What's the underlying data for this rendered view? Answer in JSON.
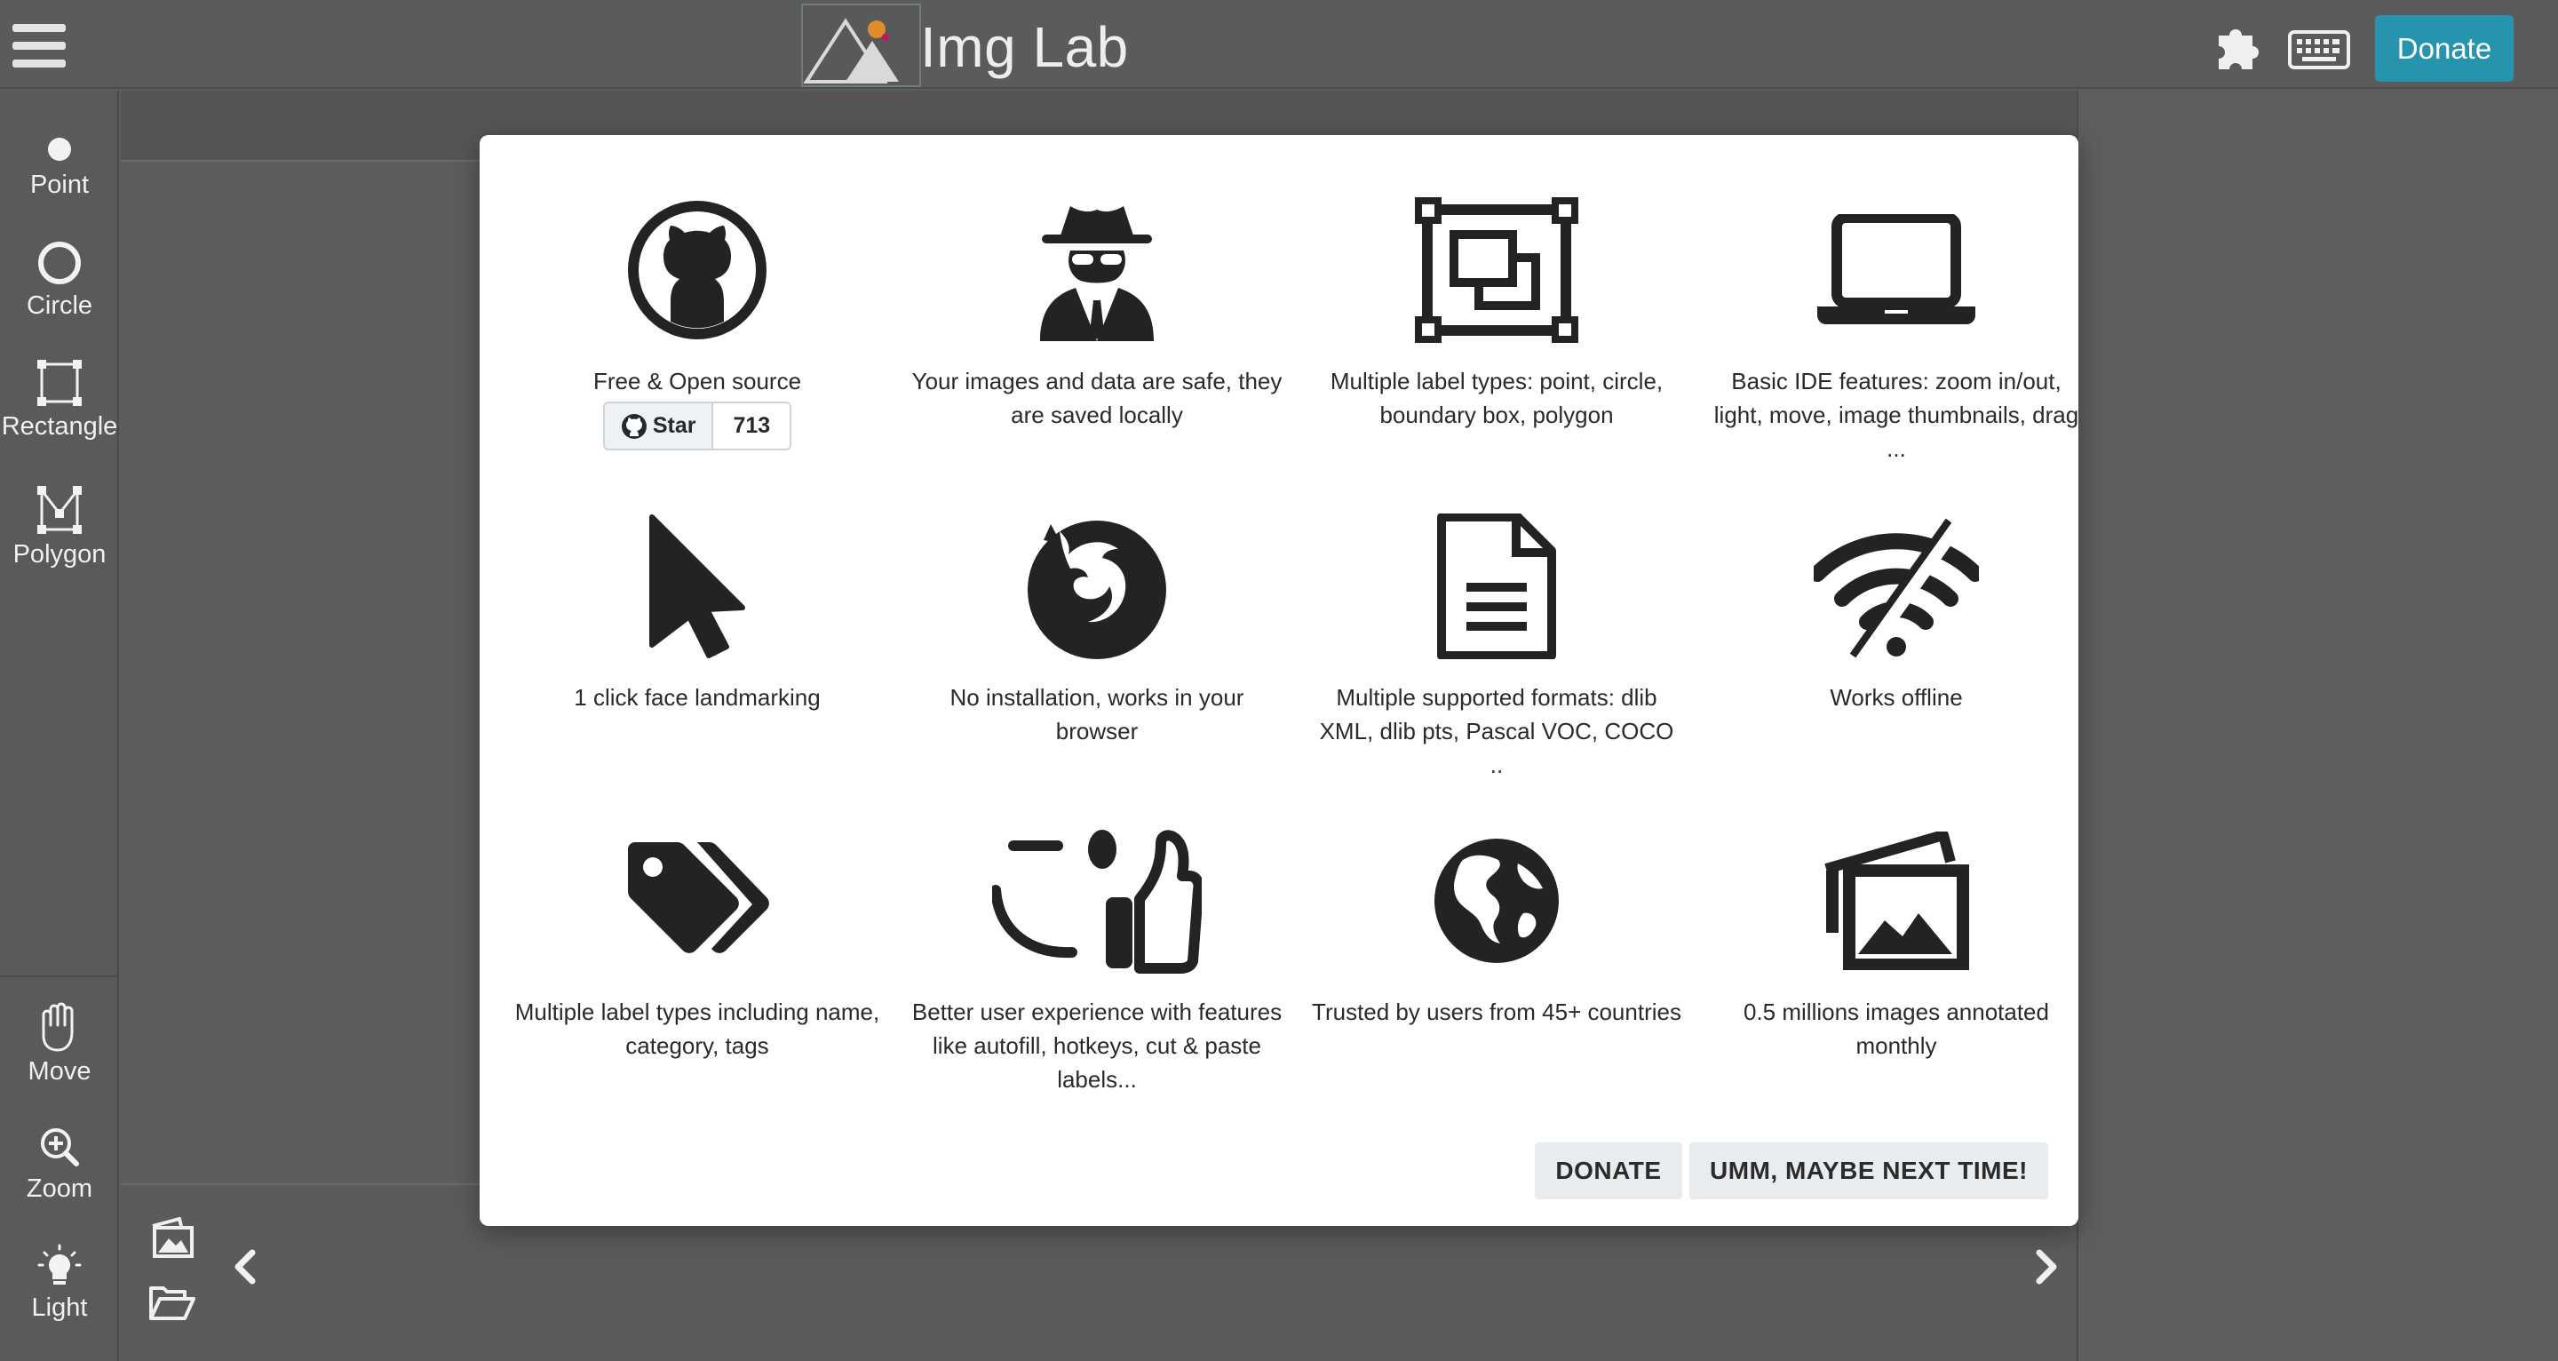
{
  "header": {
    "title": "Img Lab",
    "donate_label": "Donate",
    "icons": [
      "menu-icon",
      "logo-mountain",
      "plugin-icon",
      "keyboard-icon"
    ]
  },
  "toolbar": {
    "tools": [
      {
        "label": "Point",
        "icon": "point-icon"
      },
      {
        "label": "Circle",
        "icon": "circle-icon"
      },
      {
        "label": "Rectangle",
        "icon": "rectangle-icon"
      },
      {
        "label": "Polygon",
        "icon": "polygon-icon"
      }
    ],
    "bottom_tools": [
      {
        "label": "Move",
        "icon": "hand-icon"
      },
      {
        "label": "Zoom",
        "icon": "zoom-icon"
      },
      {
        "label": "Light",
        "icon": "lightbulb-icon"
      }
    ]
  },
  "modal": {
    "features": [
      {
        "text": "Free & Open source",
        "icon": "github-icon"
      },
      {
        "text": "Your images and data are safe, they are saved locally",
        "icon": "incognito-icon"
      },
      {
        "text": "Multiple label types: point, circle, boundary box, polygon",
        "icon": "object-group-icon"
      },
      {
        "text": "Basic IDE features: zoom in/out, light, move, image thumbnails, drag ...",
        "icon": "laptop-icon"
      },
      {
        "text": "1 click face landmarking",
        "icon": "mouse-pointer-icon"
      },
      {
        "text": "No installation, works in your browser",
        "icon": "firefox-icon"
      },
      {
        "text": "Multiple supported formats: dlib XML, dlib pts, Pascal VOC, COCO ..",
        "icon": "document-icon"
      },
      {
        "text": "Works offline",
        "icon": "wifi-off-icon"
      },
      {
        "text": "Multiple label types including name, category, tags",
        "icon": "tags-icon"
      },
      {
        "text": "Better user experience with features like autofill, hotkeys, cut & paste labels...",
        "icon": "thumbs-up-icon"
      },
      {
        "text": "Trusted by users from 45+ countries",
        "icon": "globe-icon"
      },
      {
        "text": "0.5 millions images annotated monthly",
        "icon": "images-icon"
      }
    ],
    "github": {
      "star_label": "Star",
      "count": "713"
    },
    "donate_button": "DONATE",
    "dismiss_button": "UMM, MAYBE NEXT TIME!"
  },
  "colors": {
    "accent": "#2794ad",
    "modal_bg": "#ffffff",
    "app_bg": "#5d5d5d",
    "icon_dark": "#232323"
  }
}
